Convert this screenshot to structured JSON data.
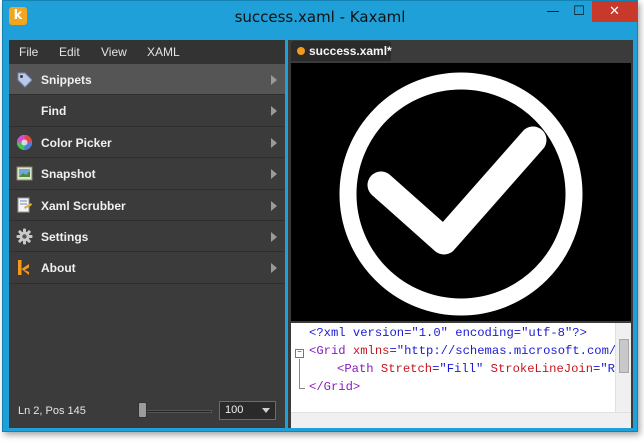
{
  "window": {
    "title": "success.xaml - Kaxaml",
    "app_icon_letter": "k"
  },
  "window_controls": {
    "minimize": "—",
    "maximize": "☐",
    "close": "✕"
  },
  "menu": [
    {
      "label": "File"
    },
    {
      "label": "Edit"
    },
    {
      "label": "View"
    },
    {
      "label": "XAML"
    }
  ],
  "nav_items": [
    {
      "label": "Snippets",
      "icon": "tag-icon",
      "active": true
    },
    {
      "label": "Find",
      "icon": "find-icon",
      "active": false
    },
    {
      "label": "Color Picker",
      "icon": "color-wheel-icon",
      "active": false
    },
    {
      "label": "Snapshot",
      "icon": "snapshot-icon",
      "active": false
    },
    {
      "label": "Xaml Scrubber",
      "icon": "scrubber-icon",
      "active": false
    },
    {
      "label": "Settings",
      "icon": "gear-icon",
      "active": false
    },
    {
      "label": "About",
      "icon": "kaxaml-logo-icon",
      "active": false
    }
  ],
  "status": {
    "position": "Ln 2, Pos 145",
    "zoom_value": "100"
  },
  "tab": {
    "label": "success.xaml*"
  },
  "code": {
    "line1": {
      "pi": "<?xml version=\"1.0\" encoding=\"utf-8\"?>"
    },
    "line2": {
      "open": "<Grid ",
      "attr": "xmlns",
      "eq": "=",
      "val": "\"http://schemas.microsoft.com/"
    },
    "line3": {
      "open": "<Path ",
      "attr1": "Stretch",
      "eq1": "=",
      "val1": "\"Fill\"",
      "attr2": " StrokeLineJoin",
      "eq2": "=",
      "val2": "\"R"
    },
    "line4": {
      "close": "</Grid>"
    }
  },
  "colors": {
    "window_frame": "#1fa0d8",
    "panel_bg": "#3b3b3b",
    "active_item": "#555555",
    "preview_bg": "#000000",
    "tab_dot": "#f39a1e",
    "close_button": "#c7392b"
  }
}
